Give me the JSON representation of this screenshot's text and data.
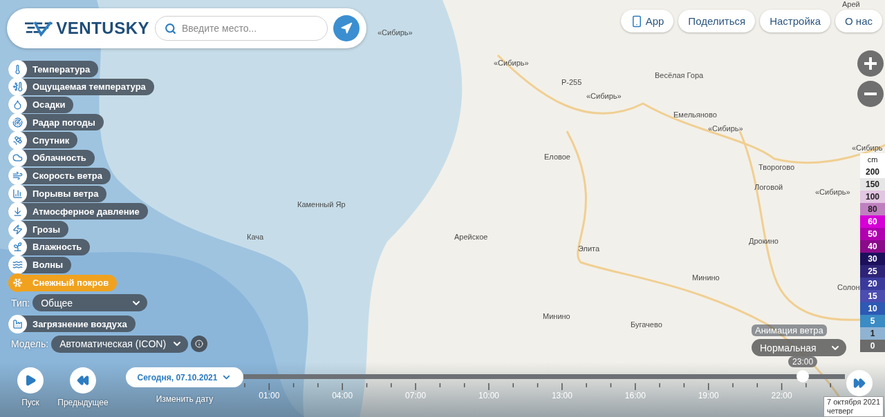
{
  "header": {
    "logo": "VENTUSKY",
    "search_placeholder": "Введите место..."
  },
  "nav": [
    {
      "label": "App",
      "kind": "app"
    },
    {
      "label": "Поделиться",
      "kind": "plain"
    },
    {
      "label": "Настройка",
      "kind": "plain"
    },
    {
      "label": "О нас",
      "kind": "plain"
    }
  ],
  "layers": [
    {
      "label": "Температура",
      "selected": false
    },
    {
      "label": "Ощущаемая температура",
      "selected": false
    },
    {
      "label": "Осадки",
      "selected": false
    },
    {
      "label": "Радар погоды",
      "selected": false
    },
    {
      "label": "Спутник",
      "selected": false
    },
    {
      "label": "Облачность",
      "selected": false
    },
    {
      "label": "Скорость ветра",
      "selected": false
    },
    {
      "label": "Порывы ветра",
      "selected": false
    },
    {
      "label": "Атмосферное давление",
      "selected": false
    },
    {
      "label": "Грозы",
      "selected": false
    },
    {
      "label": "Влажность",
      "selected": false
    },
    {
      "label": "Волны",
      "selected": false
    },
    {
      "label": "Снежный покров",
      "selected": true
    }
  ],
  "type_select": {
    "label": "Тип:",
    "value": "Общее"
  },
  "extra_layer": {
    "label": "Загрязнение воздуха",
    "selected": false
  },
  "model_select": {
    "label": "Модель:",
    "value": "Автоматическая (ICON)"
  },
  "map_labels": [
    "Арей",
    "«Сибирь»",
    "«Сибирь»",
    "Р-255",
    "«Сибирь»",
    "Весёлая Гора",
    "Емельяново",
    "«Сибирь»",
    "«Сибирь",
    "Еловое",
    "Творогово",
    "«Сибирь»",
    "Логовой",
    "Каменный Яр",
    "Кача",
    "Арейское",
    "Элита",
    "Дрокино",
    "Минино",
    "Минино",
    "Бугачево",
    "Солон"
  ],
  "legend": {
    "unit": "cm",
    "items": [
      {
        "label": "200",
        "color": "#ffffff"
      },
      {
        "label": "150",
        "color": "#e6e6e6"
      },
      {
        "label": "100",
        "color": "#e2c6e2"
      },
      {
        "label": "80",
        "color": "#bf80bf"
      },
      {
        "label": "60",
        "color": "#d600d6"
      },
      {
        "label": "50",
        "color": "#b000b0"
      },
      {
        "label": "40",
        "color": "#8a0a8a"
      },
      {
        "label": "30",
        "color": "#1c0f5c"
      },
      {
        "label": "25",
        "color": "#2e2477"
      },
      {
        "label": "20",
        "color": "#3a3a9c"
      },
      {
        "label": "15",
        "color": "#4b4db0"
      },
      {
        "label": "10",
        "color": "#2c5ab4"
      },
      {
        "label": "5",
        "color": "#3b8bc4"
      },
      {
        "label": "1",
        "color": "#8fb3d2"
      },
      {
        "label": "0",
        "color": "#6b6b6b"
      }
    ]
  },
  "wind_animation": {
    "label": "Анимация ветра",
    "value": "Нормальная"
  },
  "player": {
    "play": "Пуск",
    "previous": "Предыдущее",
    "date": "Сегодня, 07.10.2021",
    "change_date": "Изменить дату"
  },
  "timeline": {
    "hours": [
      "01:00",
      "04:00",
      "07:00",
      "10:00",
      "13:00",
      "16:00",
      "19:00",
      "22:00"
    ],
    "current": "23:00",
    "level": 0.93,
    "date_line": "7 октября 2021",
    "weekday": "четверг"
  }
}
